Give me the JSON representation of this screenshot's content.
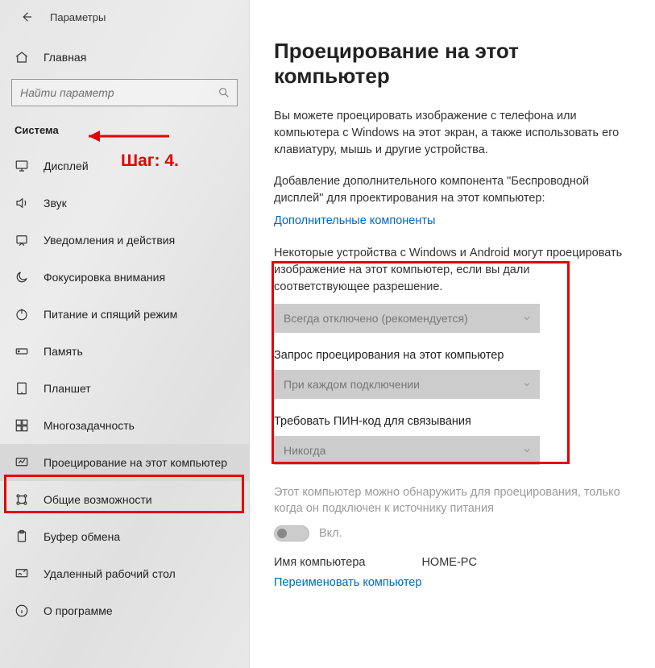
{
  "header": {
    "title": "Параметры"
  },
  "home_label": "Главная",
  "search": {
    "placeholder": "Найти параметр"
  },
  "category": "Система",
  "annotation": {
    "step_label": "Шаг: 4."
  },
  "sidebar": {
    "items": [
      {
        "label": "Дисплей"
      },
      {
        "label": "Звук"
      },
      {
        "label": "Уведомления и действия"
      },
      {
        "label": "Фокусировка внимания"
      },
      {
        "label": "Питание и спящий режим"
      },
      {
        "label": "Память"
      },
      {
        "label": "Планшет"
      },
      {
        "label": "Многозадачность"
      },
      {
        "label": "Проецирование на этот компьютер"
      },
      {
        "label": "Общие возможности"
      },
      {
        "label": "Буфер обмена"
      },
      {
        "label": "Удаленный рабочий стол"
      },
      {
        "label": "О программе"
      }
    ]
  },
  "main": {
    "title": "Проецирование на этот компьютер",
    "intro": "Вы можете проецировать изображение с телефона или компьютера с Windows на этот экран, а также использовать его клавиатуру, мышь и другие устройства.",
    "addon_text": "Добавление дополнительного компонента \"Беспроводной дисплей\" для проектирования на этот компьютер:",
    "addon_link": "Дополнительные компоненты",
    "perm_text": "Некоторые устройства с Windows и Android могут проецировать изображение на этот компьютер, если вы дали соответствующее разрешение.",
    "select1": {
      "value": "Всегда отключено (рекомендуется)"
    },
    "group2_label": "Запрос проецирования на этот компьютер",
    "select2": {
      "value": "При каждом подключении"
    },
    "group3_label": "Требовать ПИН-код для связывания",
    "select3": {
      "value": "Никогда"
    },
    "power_text": "Этот компьютер можно обнаружить для проецирования, только когда он подключен к источнику питания",
    "toggle_label": "Вкл.",
    "pc_name_label": "Имя компьютера",
    "pc_name_value": "HOME-PC",
    "rename_link": "Переименовать компьютер"
  }
}
